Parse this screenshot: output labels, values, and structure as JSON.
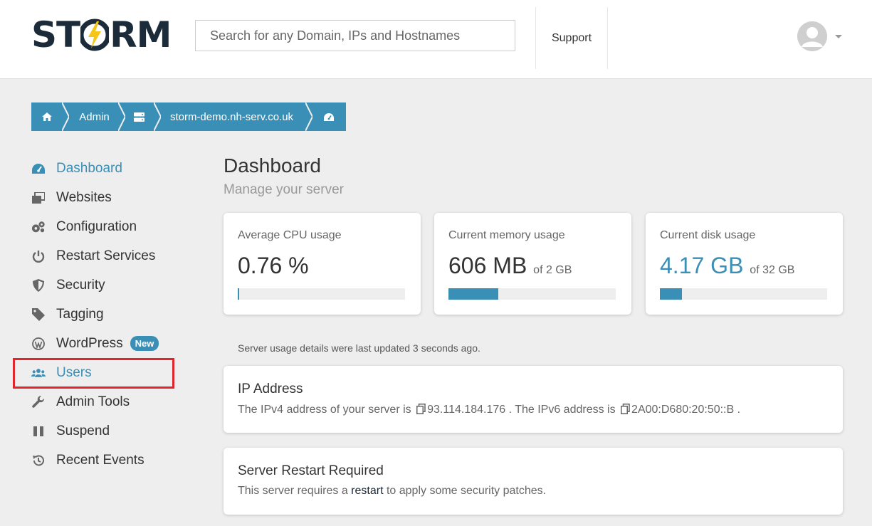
{
  "brand": {
    "name_left": "ST",
    "name_right": "RM",
    "bolt_color": "#f5c518",
    "text_color": "#1c2b3a"
  },
  "search": {
    "placeholder": "Search for any Domain, IPs and Hostnames"
  },
  "header": {
    "support_label": "Support"
  },
  "breadcrumb": {
    "admin": "Admin",
    "server": "storm-demo.nh-serv.co.uk"
  },
  "sidebar": {
    "items": [
      {
        "label": "Dashboard",
        "icon": "tachometer-icon"
      },
      {
        "label": "Websites",
        "icon": "windows-icon"
      },
      {
        "label": "Configuration",
        "icon": "gears-icon"
      },
      {
        "label": "Restart Services",
        "icon": "power-icon"
      },
      {
        "label": "Security",
        "icon": "shield-icon"
      },
      {
        "label": "Tagging",
        "icon": "tag-icon"
      },
      {
        "label": "WordPress",
        "icon": "wordpress-icon",
        "badge": "New"
      },
      {
        "label": "Users",
        "icon": "users-icon"
      },
      {
        "label": "Admin Tools",
        "icon": "wrench-icon"
      },
      {
        "label": "Suspend",
        "icon": "pause-icon"
      },
      {
        "label": "Recent Events",
        "icon": "history-icon"
      }
    ]
  },
  "main": {
    "title": "Dashboard",
    "subtitle": "Manage your server",
    "stats": {
      "cpu": {
        "label": "Average CPU usage",
        "value": "0.76 %",
        "of": "",
        "fill": 0.0076
      },
      "memory": {
        "label": "Current memory usage",
        "value": "606 MB",
        "of": "of 2 GB",
        "fill": 0.296
      },
      "disk": {
        "label": "Current disk usage",
        "value": "4.17 GB",
        "of": "of 32 GB",
        "fill": 0.13
      }
    },
    "updated": "Server usage details were last updated 3 seconds ago.",
    "ip": {
      "title": "IP Address",
      "text1": "The IPv4 address of your server is",
      "ipv4": "93.114.184.176",
      "text2": ". The IPv6 address is",
      "ipv6": "2A00:D680:20:50::B",
      "text3": "."
    },
    "restart": {
      "title": "Server Restart Required",
      "text1": "This server requires a",
      "link": "restart",
      "text2": "to apply some security patches."
    }
  },
  "colors": {
    "accent": "#3a8fb7",
    "highlight": "#e0262c"
  }
}
